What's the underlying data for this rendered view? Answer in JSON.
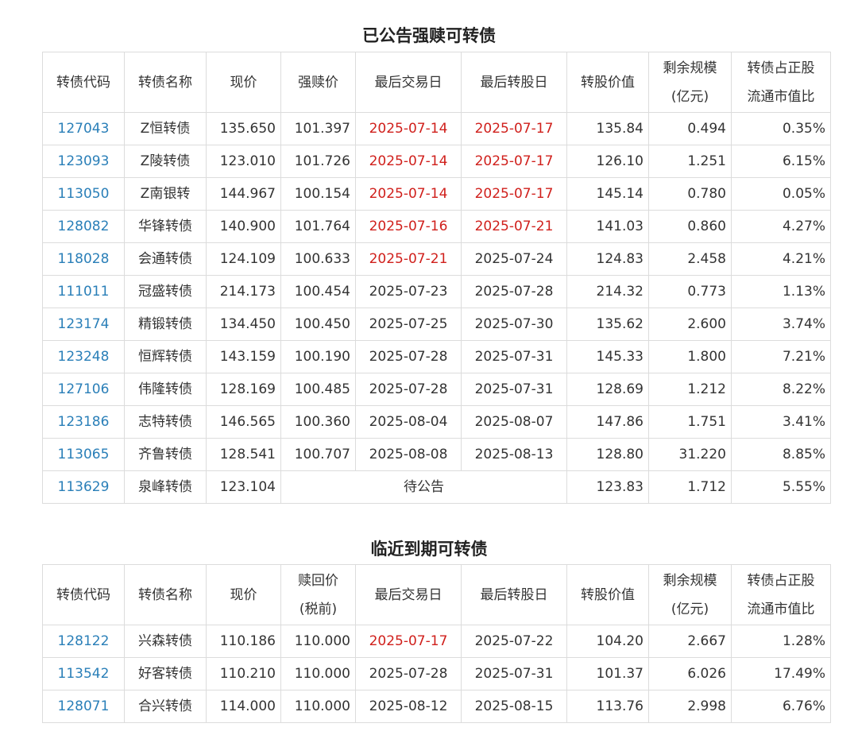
{
  "section1": {
    "title": "已公告强赎可转债",
    "headers": {
      "code": "转债代码",
      "name": "转债名称",
      "price": "现价",
      "redeem_price": "强赎价",
      "last_trade": "最后交易日",
      "last_convert": "最后转股日",
      "conv_value": "转股价值",
      "remain_1": "剩余规模",
      "remain_2": "(亿元)",
      "ratio_1": "转债占正股",
      "ratio_2": "流通市值比"
    },
    "rows": [
      {
        "code": "127043",
        "name": "Z恒转债",
        "price": "135.650",
        "redeem_price": "101.397",
        "last_trade": "2025-07-14",
        "last_convert": "2025-07-17",
        "conv_value": "135.84",
        "remain": "0.494",
        "ratio": "0.35%"
      },
      {
        "code": "123093",
        "name": "Z陵转债",
        "price": "123.010",
        "redeem_price": "101.726",
        "last_trade": "2025-07-14",
        "last_convert": "2025-07-17",
        "conv_value": "126.10",
        "remain": "1.251",
        "ratio": "6.15%"
      },
      {
        "code": "113050",
        "name": "Z南银转",
        "price": "144.967",
        "redeem_price": "100.154",
        "last_trade": "2025-07-14",
        "last_convert": "2025-07-17",
        "conv_value": "145.14",
        "remain": "0.780",
        "ratio": "0.05%"
      },
      {
        "code": "128082",
        "name": "华锋转债",
        "price": "140.900",
        "redeem_price": "101.764",
        "last_trade": "2025-07-16",
        "last_convert": "2025-07-21",
        "conv_value": "141.03",
        "remain": "0.860",
        "ratio": "4.27%"
      },
      {
        "code": "118028",
        "name": "会通转债",
        "price": "124.109",
        "redeem_price": "100.633",
        "last_trade": "2025-07-21",
        "last_convert": "2025-07-24",
        "conv_value": "124.83",
        "remain": "2.458",
        "ratio": "4.21%"
      },
      {
        "code": "111011",
        "name": "冠盛转债",
        "price": "214.173",
        "redeem_price": "100.454",
        "last_trade": "2025-07-23",
        "last_convert": "2025-07-28",
        "conv_value": "214.32",
        "remain": "0.773",
        "ratio": "1.13%"
      },
      {
        "code": "123174",
        "name": "精锻转债",
        "price": "134.450",
        "redeem_price": "100.450",
        "last_trade": "2025-07-25",
        "last_convert": "2025-07-30",
        "conv_value": "135.62",
        "remain": "2.600",
        "ratio": "3.74%"
      },
      {
        "code": "123248",
        "name": "恒辉转债",
        "price": "143.159",
        "redeem_price": "100.190",
        "last_trade": "2025-07-28",
        "last_convert": "2025-07-31",
        "conv_value": "145.33",
        "remain": "1.800",
        "ratio": "7.21%"
      },
      {
        "code": "127106",
        "name": "伟隆转债",
        "price": "128.169",
        "redeem_price": "100.485",
        "last_trade": "2025-07-28",
        "last_convert": "2025-07-31",
        "conv_value": "128.69",
        "remain": "1.212",
        "ratio": "8.22%"
      },
      {
        "code": "123186",
        "name": "志特转债",
        "price": "146.565",
        "redeem_price": "100.360",
        "last_trade": "2025-08-04",
        "last_convert": "2025-08-07",
        "conv_value": "147.86",
        "remain": "1.751",
        "ratio": "3.41%"
      },
      {
        "code": "113065",
        "name": "齐鲁转债",
        "price": "128.541",
        "redeem_price": "100.707",
        "last_trade": "2025-08-08",
        "last_convert": "2025-08-13",
        "conv_value": "128.80",
        "remain": "31.220",
        "ratio": "8.85%"
      }
    ],
    "pending_row": {
      "code": "113629",
      "name": "泉峰转债",
      "price": "123.104",
      "pending_text": "待公告",
      "conv_value": "123.83",
      "remain": "1.712",
      "ratio": "5.55%"
    }
  },
  "section2": {
    "title": "临近到期可转债",
    "headers": {
      "code": "转债代码",
      "name": "转债名称",
      "price": "现价",
      "redeem_1": "赎回价",
      "redeem_2": "(税前)",
      "last_trade": "最后交易日",
      "last_convert": "最后转股日",
      "conv_value": "转股价值",
      "remain_1": "剩余规模",
      "remain_2": "(亿元)",
      "ratio_1": "转债占正股",
      "ratio_2": "流通市值比"
    },
    "rows": [
      {
        "code": "128122",
        "name": "兴森转债",
        "price": "110.186",
        "redeem_price": "110.000",
        "last_trade": "2025-07-17",
        "last_convert": "2025-07-22",
        "conv_value": "104.20",
        "remain": "2.667",
        "ratio": "1.28%"
      },
      {
        "code": "113542",
        "name": "好客转债",
        "price": "110.210",
        "redeem_price": "110.000",
        "last_trade": "2025-07-28",
        "last_convert": "2025-07-31",
        "conv_value": "101.37",
        "remain": "6.026",
        "ratio": "17.49%"
      },
      {
        "code": "128071",
        "name": "合兴转债",
        "price": "114.000",
        "redeem_price": "110.000",
        "last_trade": "2025-08-12",
        "last_convert": "2025-08-15",
        "conv_value": "113.76",
        "remain": "2.998",
        "ratio": "6.76%"
      }
    ]
  },
  "colors": {
    "link": "#2a7fb8",
    "highlight_red": "#d0201c",
    "border": "#dcdcdc"
  }
}
